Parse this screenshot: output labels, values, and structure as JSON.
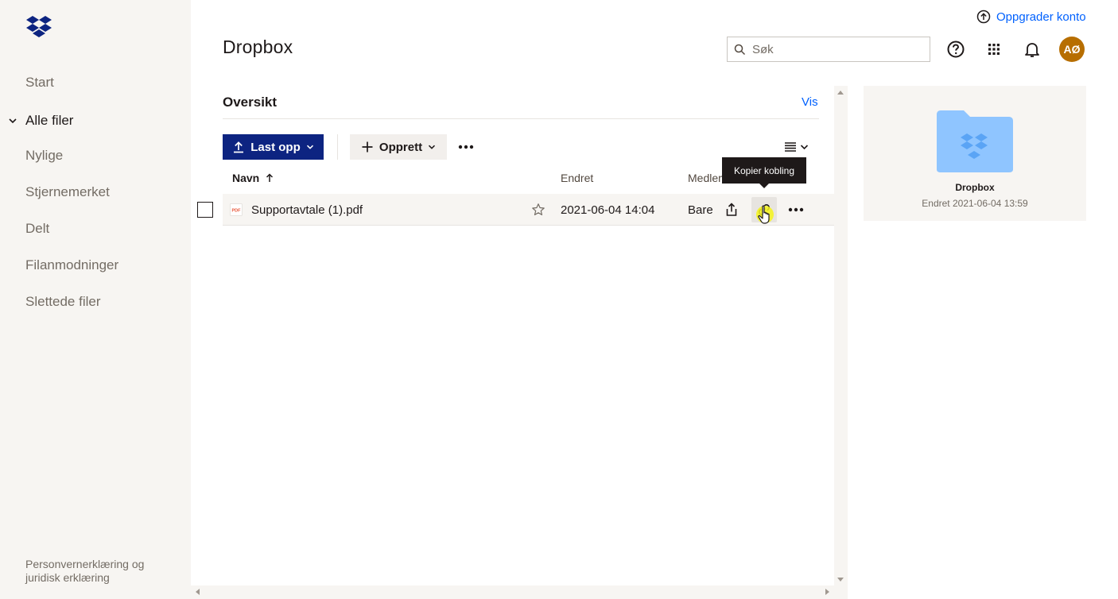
{
  "colors": {
    "brand_blue": "#0061fe",
    "dark_blue": "#0d2481",
    "folder_blue": "#8fc5ff",
    "avatar_bg": "#b76e00",
    "sidebar_bg": "#f7f5f2"
  },
  "sidebar": {
    "logo_icon": "dropbox-logo-icon",
    "items": [
      {
        "label": "Start"
      },
      {
        "label": "Alle filer",
        "expanded": true
      },
      {
        "label": "Nylige"
      },
      {
        "label": "Stjernemerket"
      },
      {
        "label": "Delt"
      },
      {
        "label": "Filanmodninger"
      },
      {
        "label": "Slettede filer"
      }
    ],
    "footer": "Personvernerklæring og juridisk erklæring"
  },
  "header": {
    "upgrade_label": "Oppgrader konto",
    "title": "Dropbox",
    "search_placeholder": "Søk",
    "avatar_initials": "AØ",
    "icons": [
      "help-icon",
      "app-grid-icon",
      "bell-icon"
    ]
  },
  "overview": {
    "title": "Oversikt",
    "link": "Vis"
  },
  "toolbar": {
    "upload_label": "Last opp",
    "create_label": "Opprett"
  },
  "table": {
    "columns": {
      "name": "Navn",
      "modified": "Endret",
      "members": "Medlemmer"
    },
    "rows": [
      {
        "name": "Supportavtale (1).pdf",
        "modified": "2021-06-04 14:04",
        "members": "Bare du"
      }
    ]
  },
  "tooltip": "Kopier kobling",
  "preview": {
    "name": "Dropbox",
    "meta": "Endret 2021-06-04 13:59"
  }
}
